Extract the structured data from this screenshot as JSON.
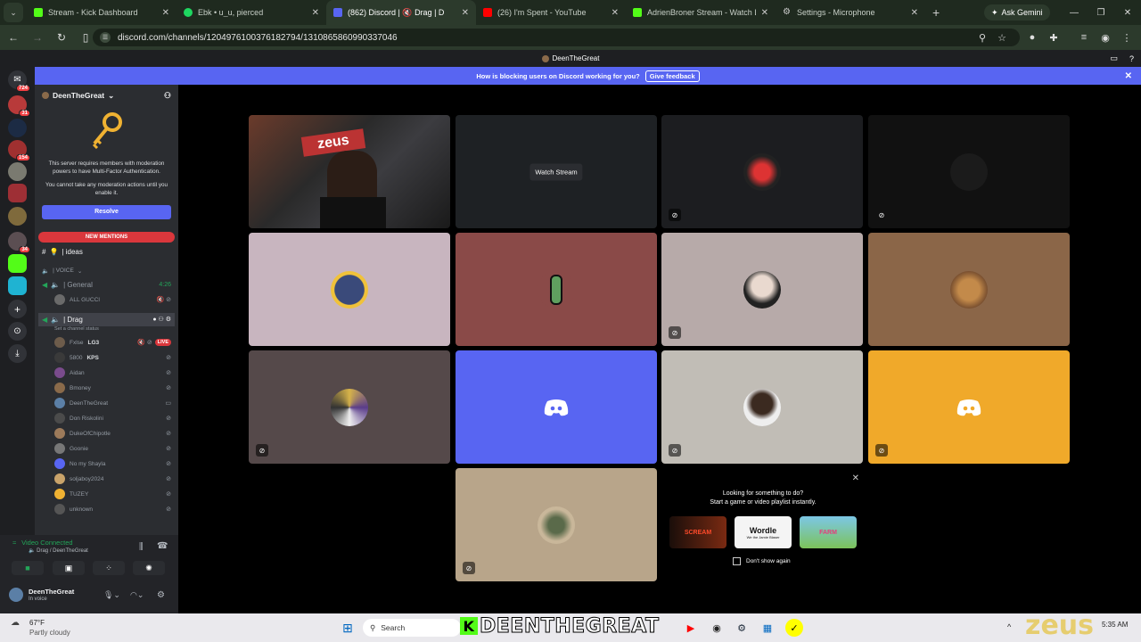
{
  "browser": {
    "tabs": [
      {
        "title": "Stream - Kick Dashboard",
        "color": "#53fc18"
      },
      {
        "title": "Ebk • u_u, pierced",
        "color": "#1ed760"
      },
      {
        "title": "(862) Discord | 🔇 Drag | D",
        "color": "#5865f2"
      },
      {
        "title": "(26) I'm Spent - YouTube",
        "color": "#ff0000"
      },
      {
        "title": "AdrienBroner Stream - Watch L",
        "color": "#53fc18"
      },
      {
        "title": "Settings - Microphone",
        "color": "#9aa0a6"
      }
    ],
    "new_tab": "+",
    "ask_gemini": "Ask Gemini",
    "url": "discord.com/channels/1204976100376182794/1310865860990337046"
  },
  "discord": {
    "window_title": "DeenTheGreat",
    "banner_text": "How is blocking users on Discord working for you?",
    "banner_button": "Give feedback",
    "guild_badges": [
      "724",
      "31",
      "154",
      "34"
    ],
    "server_name": "DeenTheGreat",
    "mfa_text1": "This server requires members with moderation powers to have Multi-Factor Authentication.",
    "mfa_text2": "You cannot take any moderation actions until you enable it.",
    "resolve": "Resolve",
    "new_mentions": "NEW MENTIONS",
    "channel_ideas": "| ideas",
    "voice_category": "| VOICE",
    "general": "| General",
    "general_time": "4:26",
    "drag": "| Drag",
    "drag_status": "Set a channel status",
    "general_members": [
      "ALL GUCCI"
    ],
    "drag_members": [
      {
        "name": "Fxlse",
        "tag": "LG3",
        "color": "#6d5c4b"
      },
      {
        "name": "5800",
        "tag": "KPS",
        "color": "#3a3a3a"
      },
      {
        "name": "Aidan",
        "tag": "",
        "color": "#7a4b8c"
      },
      {
        "name": "Bmoney",
        "tag": "",
        "color": "#8a6a4a"
      },
      {
        "name": "DeenTheGreat",
        "tag": "",
        "color": "#5b7fa6"
      },
      {
        "name": "Don Riskolini",
        "tag": "",
        "color": "#4b4b4b"
      },
      {
        "name": "DukeOfChipotle",
        "tag": "",
        "color": "#9c7a5a"
      },
      {
        "name": "Goonie",
        "tag": "",
        "color": "#777"
      },
      {
        "name": "No my Shayla",
        "tag": "",
        "color": "#5865f2"
      },
      {
        "name": "soljaboy2024",
        "tag": "",
        "color": "#c9a36a"
      },
      {
        "name": "TUZEY",
        "tag": "",
        "color": "#f0b232"
      },
      {
        "name": "unknown",
        "tag": "",
        "color": "#555"
      }
    ],
    "live": "LIVE",
    "video_connected": "Video Connected",
    "voice_location": "Drag / DeenTheGreat",
    "user_name": "DeenTheGreat",
    "user_status": "In voice",
    "watch_stream": "Watch Stream",
    "activity_title": "Looking for something to do?",
    "activity_sub": "Start a game or video playlist instantly.",
    "activities": [
      "SCREAM",
      "Wordle",
      "FARM"
    ],
    "wordle_sub": "We the Jamie Blaser",
    "dont_show": "Don't show again"
  },
  "taskbar": {
    "weather_temp": "67°F",
    "weather_desc": "Partly cloudy",
    "search": "Search",
    "overlay_text": "DEENTHEGREAT",
    "overlay_k": "K",
    "watermark": "zeus",
    "clock": "5:35 AM"
  }
}
